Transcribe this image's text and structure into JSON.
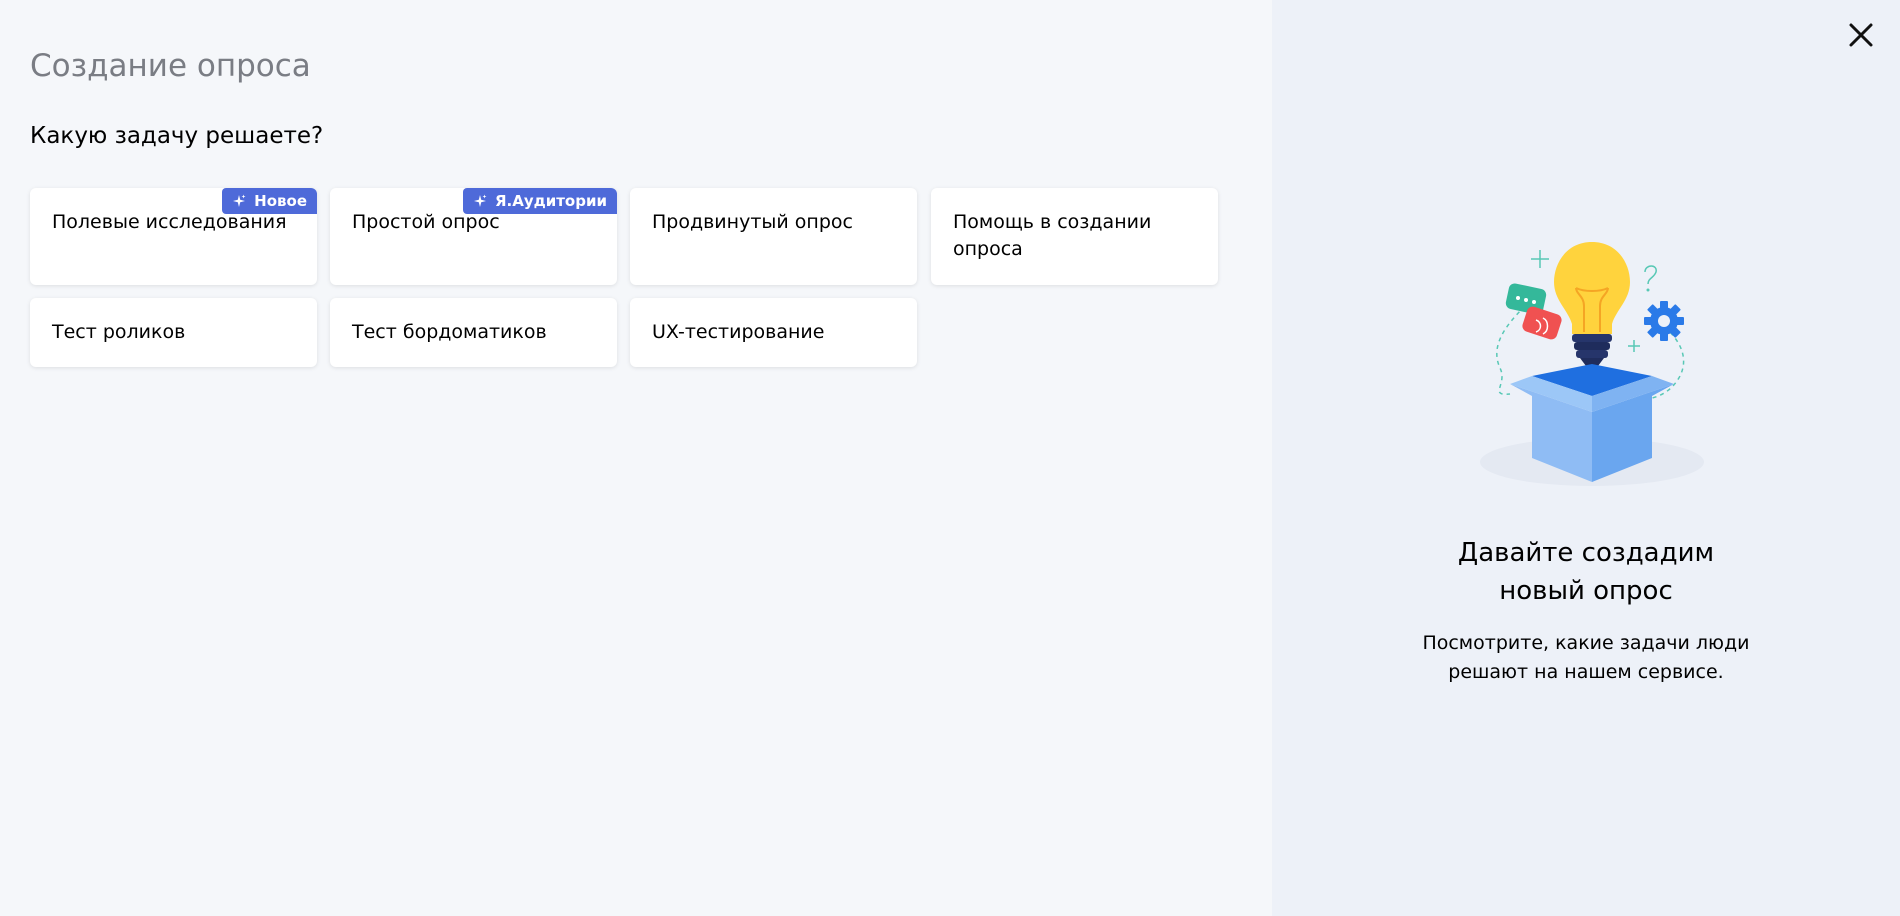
{
  "header": {
    "title": "Создание опроса"
  },
  "question": "Какую задачу решаете?",
  "cards": [
    {
      "label": "Полевые исследования",
      "badge": "Новое"
    },
    {
      "label": "Простой опрос",
      "badge": "Я.Аудитории"
    },
    {
      "label": "Продвинутый опрос"
    },
    {
      "label": "Помощь в создании опроса"
    },
    {
      "label": "Тест роликов"
    },
    {
      "label": "Тест бордоматиков"
    },
    {
      "label": "UX-тестирование"
    }
  ],
  "promo": {
    "title_line1": "Давайте создадим",
    "title_line2": "новый опрос",
    "text_line1": "Посмотрите, какие задачи люди",
    "text_line2": "решают на нашем сервисе."
  },
  "icons": {
    "close": "close-icon",
    "sparkle": "sparkle-icon",
    "illustration": "lightbulb-box-illustration"
  },
  "colors": {
    "badge": "#4e6ad9",
    "aside_background": "#edf1f8",
    "main_background": "#f5f7fa"
  }
}
